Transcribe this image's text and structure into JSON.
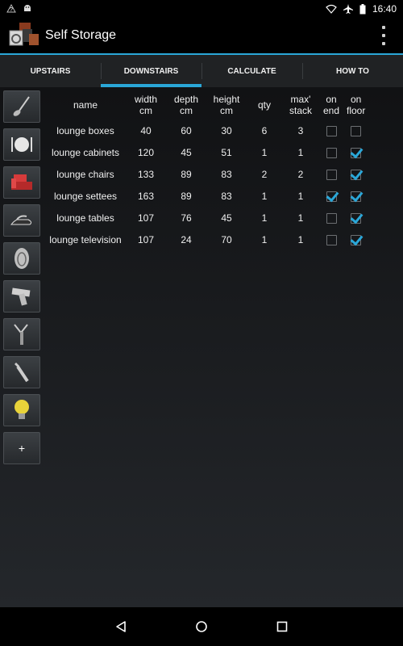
{
  "status_bar": {
    "time": "16:40",
    "icons": [
      "notification-question-icon",
      "android-icon",
      "wifi-icon",
      "airplane-icon",
      "battery-icon"
    ]
  },
  "app": {
    "title": "Self Storage",
    "logo_icon": "storage-boxes-icon"
  },
  "tabs": [
    {
      "label": "UPSTAIRS",
      "active": false
    },
    {
      "label": "DOWNSTAIRS",
      "active": true
    },
    {
      "label": "CALCULATE",
      "active": false
    },
    {
      "label": "HOW TO",
      "active": false
    }
  ],
  "sidebar": {
    "items": [
      {
        "icon": "kitchen-ladle-icon"
      },
      {
        "icon": "dining-plate-icon"
      },
      {
        "icon": "lounge-sofa-icon"
      },
      {
        "icon": "iron-icon"
      },
      {
        "icon": "washing-machine-icon"
      },
      {
        "icon": "drill-icon"
      },
      {
        "icon": "garden-tool-icon"
      },
      {
        "icon": "wrench-icon"
      },
      {
        "icon": "light-bulb-icon"
      },
      {
        "icon": "add-icon",
        "label": "+"
      }
    ]
  },
  "table": {
    "headers": {
      "name": "name",
      "width": "width",
      "width_unit": "cm",
      "depth": "depth",
      "depth_unit": "cm",
      "height": "height",
      "height_unit": "cm",
      "qty": "qty",
      "max": "max'",
      "stack": "stack",
      "on_end_1": "on",
      "on_end_2": "end",
      "on_floor_1": "on",
      "on_floor_2": "floor"
    },
    "rows": [
      {
        "name": "lounge boxes",
        "width": "40",
        "depth": "60",
        "height": "30",
        "qty": "6",
        "max_stack": "3",
        "on_end": false,
        "on_floor": false
      },
      {
        "name": "lounge cabinets",
        "width": "120",
        "depth": "45",
        "height": "51",
        "qty": "1",
        "max_stack": "1",
        "on_end": false,
        "on_floor": true
      },
      {
        "name": "lounge chairs",
        "width": "133",
        "depth": "89",
        "height": "83",
        "qty": "2",
        "max_stack": "2",
        "on_end": false,
        "on_floor": true
      },
      {
        "name": "lounge settees",
        "width": "163",
        "depth": "89",
        "height": "83",
        "qty": "1",
        "max_stack": "1",
        "on_end": true,
        "on_floor": true
      },
      {
        "name": "lounge tables",
        "width": "107",
        "depth": "76",
        "height": "45",
        "qty": "1",
        "max_stack": "1",
        "on_end": false,
        "on_floor": true
      },
      {
        "name": "lounge television",
        "width": "107",
        "depth": "24",
        "height": "70",
        "qty": "1",
        "max_stack": "1",
        "on_end": false,
        "on_floor": true
      }
    ]
  },
  "nav_bar": {
    "icons": [
      "back-icon",
      "home-icon",
      "recents-icon"
    ]
  },
  "colors": {
    "accent": "#2aa7d8",
    "tab_bg": "#202224",
    "content_top": "#111214",
    "content_bottom": "#24272b"
  }
}
